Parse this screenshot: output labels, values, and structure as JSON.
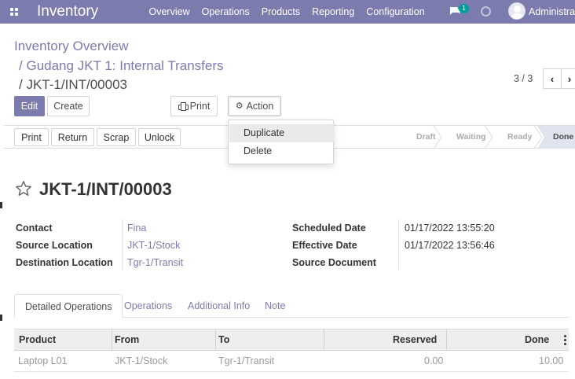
{
  "navbar": {
    "app_name": "Inventory",
    "menu": [
      "Overview",
      "Operations",
      "Products",
      "Reporting",
      "Configuration"
    ],
    "chat_badge": "1",
    "user_name": "Administrator",
    "colors": {
      "navbar_bg": "#7c7bad",
      "badge_bg": "#00a09d"
    }
  },
  "breadcrumb": {
    "root": "Inventory Overview",
    "mid": "Gudang JKT 1: Internal Transfers",
    "current": "JKT-1/INT/00003",
    "separator": "/"
  },
  "toolbar": {
    "edit_label": "Edit",
    "create_label": "Create",
    "print_label": "Print",
    "action_label": "Action"
  },
  "action_menu": {
    "items": [
      "Duplicate",
      "Delete"
    ]
  },
  "pager": {
    "value": "3 / 3",
    "prev": "‹",
    "next": "›"
  },
  "statusbar": {
    "buttons": [
      "Print",
      "Return",
      "Scrap",
      "Unlock"
    ],
    "stages": [
      "Draft",
      "Waiting",
      "Ready",
      "Done"
    ],
    "current_stage": "Done"
  },
  "record": {
    "title": "JKT-1/INT/00003",
    "left_fields": [
      {
        "label": "Contact",
        "value": "Fina"
      },
      {
        "label": "Source Location",
        "value": "JKT-1/Stock"
      },
      {
        "label": "Destination Location",
        "value": "Tgr-1/Transit"
      }
    ],
    "right_fields": [
      {
        "label": "Scheduled Date",
        "value": "01/17/2022 13:55:20"
      },
      {
        "label": "Effective Date",
        "value": "01/17/2022 13:56:46"
      },
      {
        "label": "Source Document",
        "value": ""
      }
    ]
  },
  "tabs": [
    "Detailed Operations",
    "Operations",
    "Additional Info",
    "Note"
  ],
  "table": {
    "columns": [
      "Product",
      "From",
      "To",
      "Reserved",
      "Done"
    ],
    "rows": [
      [
        "Laptop L01",
        "JKT-1/Stock",
        "Tgr-1/Transit",
        "0.00",
        "10.00"
      ]
    ]
  }
}
